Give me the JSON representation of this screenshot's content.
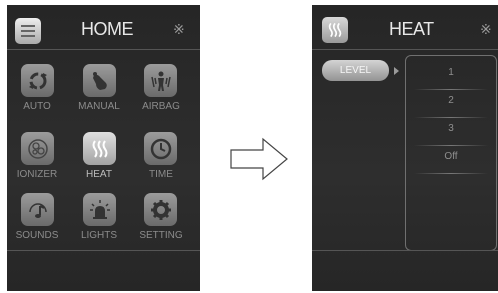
{
  "home": {
    "title": "HOME",
    "tiles": [
      {
        "label": "AUTO",
        "icon": "auto-cycle-icon"
      },
      {
        "label": "MANUAL",
        "icon": "hand-pointer-icon"
      },
      {
        "label": "AIRBAG",
        "icon": "airbag-body-icon"
      },
      {
        "label": "IONIZER",
        "icon": "ionizer-icon"
      },
      {
        "label": "HEAT",
        "icon": "heat-waves-icon",
        "selected": true
      },
      {
        "label": "TIME",
        "icon": "clock-icon"
      },
      {
        "label": "SOUNDS",
        "icon": "music-note-icon"
      },
      {
        "label": "LIGHTS",
        "icon": "lamp-icon"
      },
      {
        "label": "SETTING",
        "icon": "gear-icon"
      }
    ]
  },
  "heat": {
    "title": "HEAT",
    "level_label": "LEVEL",
    "options": [
      "1",
      "2",
      "3",
      "Off"
    ]
  },
  "icons": {
    "bluetooth": "bluetooth-icon",
    "home_menu": "menu-list-icon",
    "heat_header": "heat-waves-icon",
    "transition": "arrow-right-icon"
  },
  "colors": {
    "panel_bg": "#2a2a2a",
    "tile_default": "#7f7f7f",
    "tile_active": "#c8c8c8",
    "text": "#e8e8e8",
    "label": "#8c8c8c"
  }
}
